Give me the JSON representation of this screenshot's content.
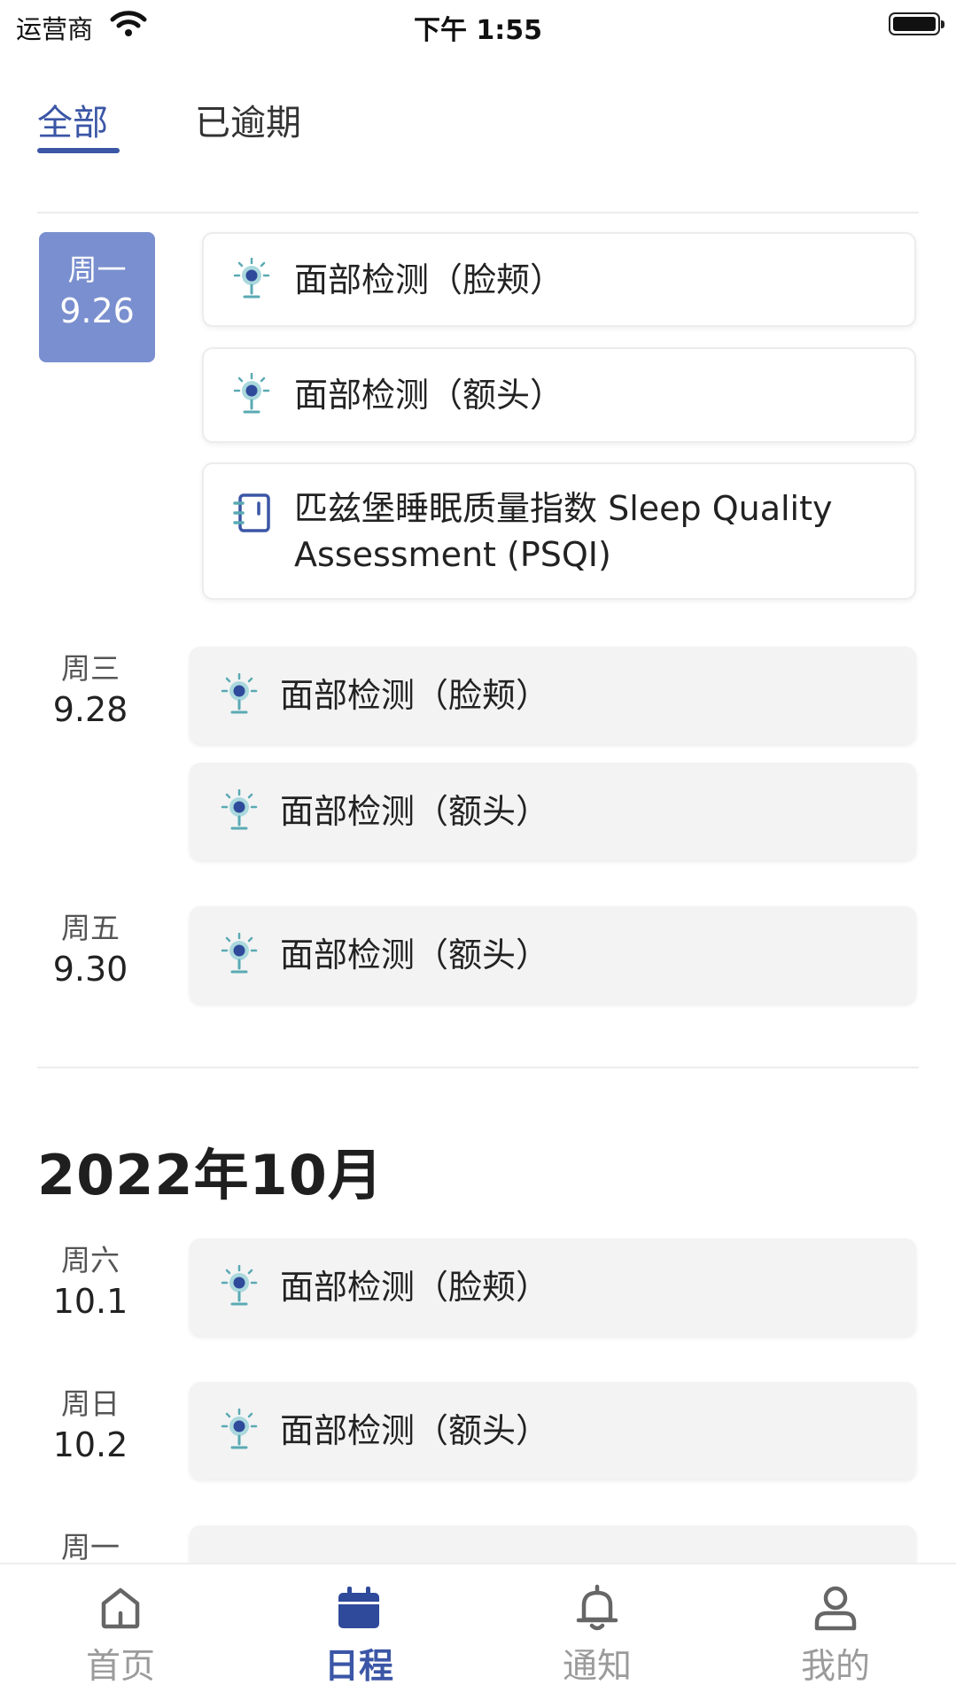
{
  "status_bar": {
    "carrier": "运营商",
    "time": "下午 1:55"
  },
  "tabs": [
    {
      "label": "全部",
      "active": true
    },
    {
      "label": "已逾期",
      "active": false
    }
  ],
  "month_title": "2022年10月",
  "days": [
    {
      "weekday": "周一",
      "date": "9.26",
      "selected": true,
      "tasks": [
        {
          "label": "面部检测（脸颊）",
          "icon": "camera-icon"
        },
        {
          "label": "面部检测（额头）",
          "icon": "camera-icon"
        },
        {
          "label": "匹兹堡睡眠质量指数 Sleep Quality Assessment (PSQI)",
          "icon": "notebook-icon"
        }
      ]
    },
    {
      "weekday": "周三",
      "date": "9.28",
      "tasks": [
        {
          "label": "面部检测（脸颊）",
          "icon": "camera-icon"
        },
        {
          "label": "面部检测（额头）",
          "icon": "camera-icon"
        }
      ]
    },
    {
      "weekday": "周五",
      "date": "9.30",
      "tasks": [
        {
          "label": "面部检测（额头）",
          "icon": "camera-icon"
        }
      ]
    },
    {
      "weekday": "周六",
      "date": "10.1",
      "tasks": [
        {
          "label": "面部检测（脸颊）",
          "icon": "camera-icon"
        }
      ]
    },
    {
      "weekday": "周日",
      "date": "10.2",
      "tasks": [
        {
          "label": "面部检测（额头）",
          "icon": "camera-icon"
        }
      ]
    },
    {
      "weekday": "周一"
    }
  ],
  "bottom_nav": [
    {
      "label": "首页",
      "icon": "home-icon",
      "active": false
    },
    {
      "label": "日程",
      "icon": "calendar-icon",
      "active": true
    },
    {
      "label": "通知",
      "icon": "bell-icon",
      "active": false
    },
    {
      "label": "我的",
      "icon": "user-icon",
      "active": false
    }
  ],
  "colors": {
    "accent": "#3b56a6",
    "selected_day_bg": "#7a8fcf",
    "icon_teal": "#5aaab3"
  }
}
